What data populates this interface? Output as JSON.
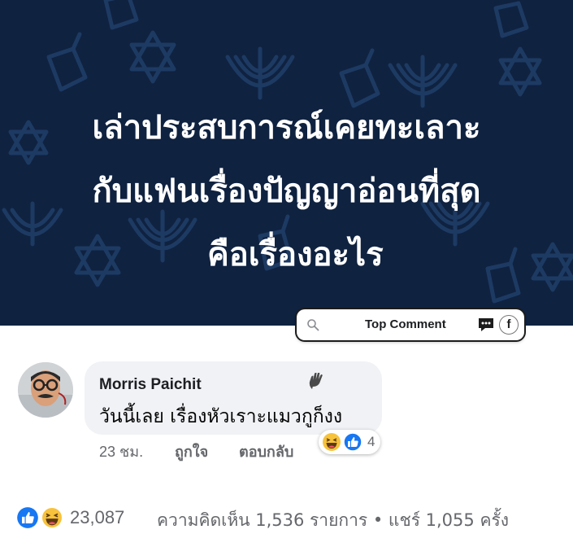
{
  "post": {
    "headline_lines": [
      "เล่าประสบการณ์เคยทะเลาะ",
      "กับแฟนเรื่องปัญญาอ่อนที่สุด",
      "คือเรื่องอะไร"
    ]
  },
  "comment_bar": {
    "label": "Top Comment",
    "icons": [
      "search-icon",
      "chat-bubble-icon",
      "facebook-icon"
    ],
    "fb_glyph": "f"
  },
  "comment": {
    "author": "Morris Paichit",
    "text": "วันนี้เลย เรื่องหัวเราะแมวกูก็งง",
    "time": "23 ชม.",
    "like_label": "ถูกใจ",
    "reply_label": "ตอบกลับ",
    "reaction_count": "4",
    "reactions": [
      "haha",
      "like"
    ]
  },
  "footer": {
    "reactions": [
      "like",
      "haha"
    ],
    "reaction_count": "23,087",
    "stats": "ความคิดเห็น 1,536 รายการ • แชร์ 1,055 ครั้ง"
  },
  "colors": {
    "banner": "#0f2240",
    "bubble": "#f0f2f5",
    "like_blue": "#1877f2",
    "haha_yellow": "#f7c23c"
  }
}
